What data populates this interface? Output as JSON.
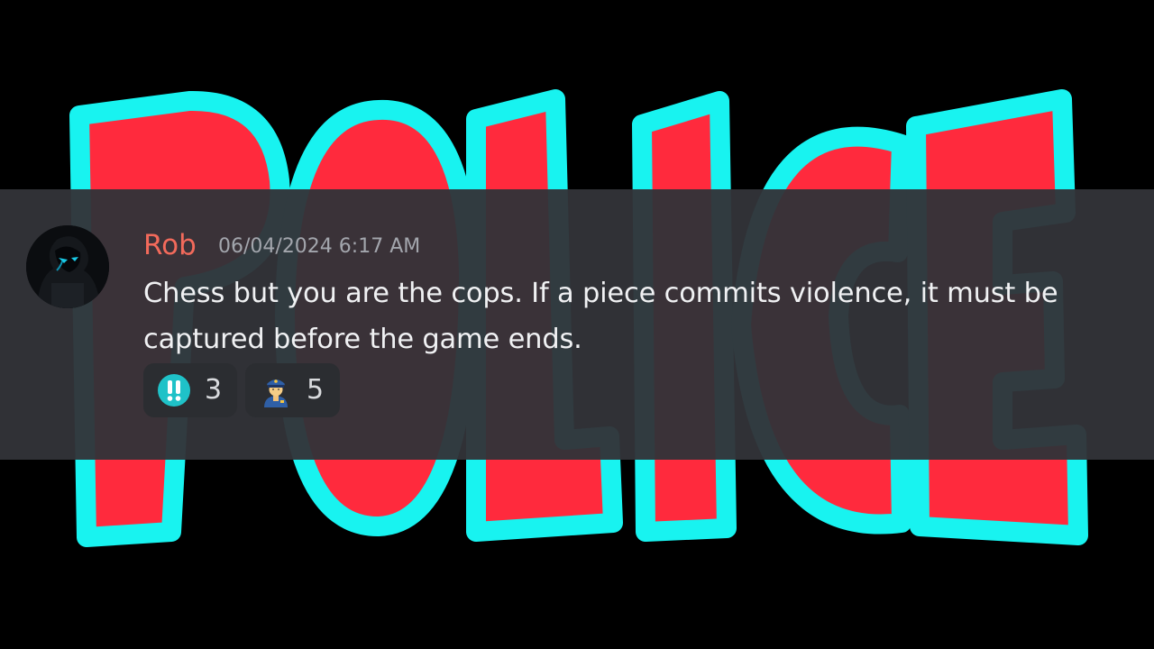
{
  "background": {
    "word": "POLICE",
    "letter_fill": "#ff2a3d",
    "letter_outline": "#18f3f0",
    "backdrop": "#000000"
  },
  "message": {
    "author": "Rob",
    "author_color": "#f26a5b",
    "timestamp": "06/04/2024 6:17 AM",
    "text": "Chess but you are the cops. If a piece commits violence, it must be captured before the game ends.",
    "avatar_icon": "hooded-figure-icon"
  },
  "reactions": [
    {
      "emoji": "double-exclamation-icon",
      "count": "3"
    },
    {
      "emoji": "police-officer-icon",
      "count": "5"
    }
  ]
}
